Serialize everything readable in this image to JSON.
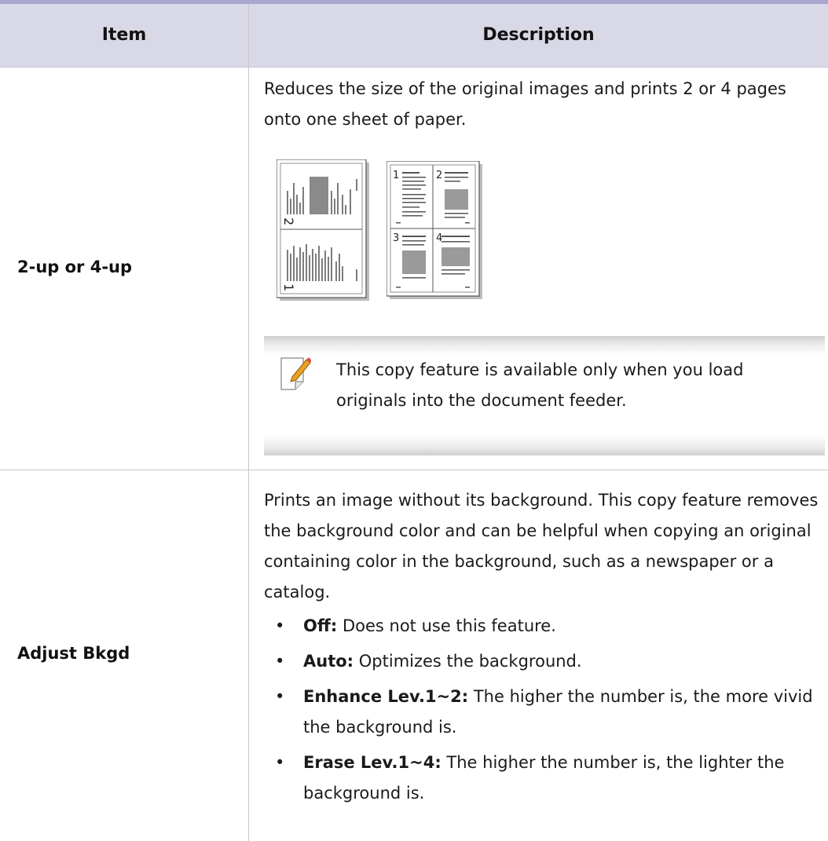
{
  "table": {
    "headers": {
      "item": "Item",
      "description": "Description"
    },
    "rows": [
      {
        "item": "2-up or 4-up",
        "description": "Reduces the size of the original images and prints 2 or 4 pages onto one sheet of paper.",
        "figure": {
          "two_up_labels": [
            "2",
            "1"
          ],
          "four_up_labels": [
            "1",
            "2",
            "3",
            "4"
          ]
        },
        "note": "This copy feature is available only when you load originals into the document feeder."
      },
      {
        "item": "Adjust Bkgd",
        "description": "Prints an image without its background. This copy feature removes the background color and can be helpful when copying an original containing color in the background, such as a newspaper or a catalog.",
        "options": [
          {
            "label": "Off:",
            "text": "Does not use this feature."
          },
          {
            "label": "Auto:",
            "text": "Optimizes the background."
          },
          {
            "label": "Enhance Lev.1~2:",
            "text": "The higher the number is, the more vivid the background is."
          },
          {
            "label": "Erase Lev.1~4:",
            "text": "The higher the number is, the lighter the background is."
          }
        ]
      }
    ]
  },
  "colors": {
    "header_bg": "#d8d8e6",
    "top_rule": "#a9a7cf",
    "note_pencil": "#f0a020"
  },
  "icons": {
    "note": "note-pencil-icon"
  }
}
